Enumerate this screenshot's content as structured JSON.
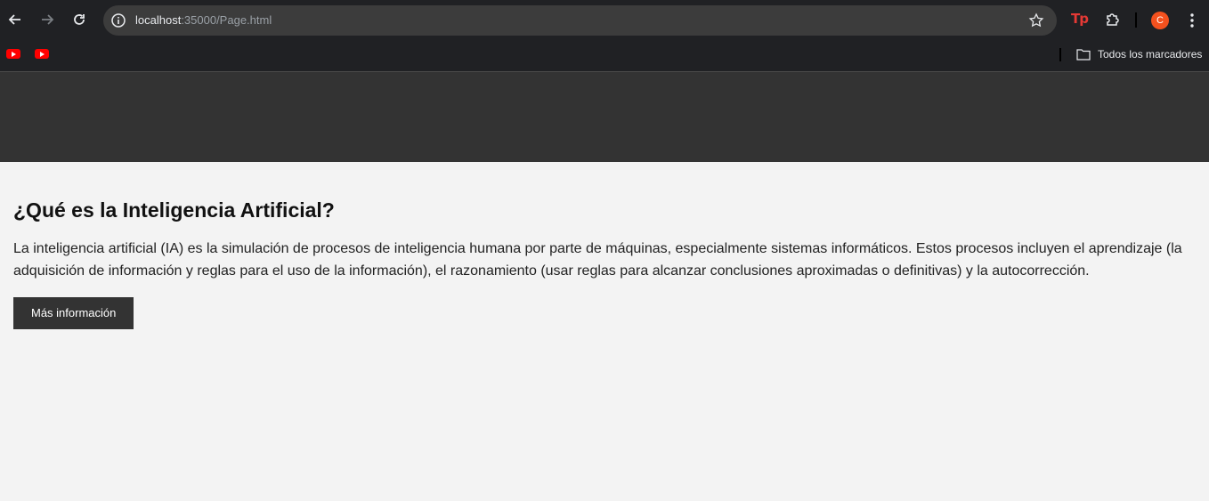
{
  "browser": {
    "url_host": "localhost",
    "url_rest": ":35000/Page.html",
    "profile_initial": "C",
    "extension_label": "Tp",
    "bookmarks_all_label": "Todos los marcadores",
    "icons": {
      "back": "back-arrow-icon",
      "forward": "forward-arrow-icon",
      "reload": "reload-icon",
      "info": "info-icon",
      "star": "star-icon",
      "puzzle": "extensions-puzzle-icon",
      "menu": "kebab-menu-icon",
      "folder": "folder-icon",
      "youtube": "youtube-icon"
    },
    "colors": {
      "chrome_bg": "#202124",
      "omnibox_bg": "#3c3c3c",
      "avatar_bg": "#f4511e",
      "youtube_red": "#ff0000",
      "extension_red": "#e53935"
    }
  },
  "page": {
    "header_bg": "#333333",
    "body_bg": "#f3f3f3",
    "title": "¿Qué es la Inteligencia Artificial?",
    "paragraph": "La inteligencia artificial (IA) es la simulación de procesos de inteligencia humana por parte de máquinas, especialmente sistemas informáticos. Estos procesos incluyen el aprendizaje (la adquisición de información y reglas para el uso de la información), el razonamiento (usar reglas para alcanzar conclusiones aproximadas o definitivas) y la autocorrección.",
    "button_label": "Más información"
  }
}
